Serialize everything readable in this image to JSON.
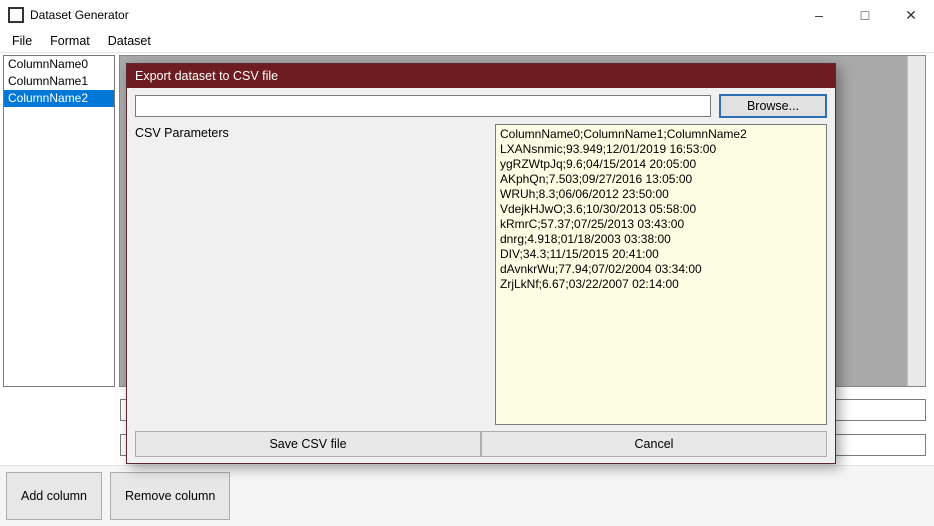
{
  "window": {
    "title": "Dataset Generator"
  },
  "menubar": {
    "file": "File",
    "format": "Format",
    "dataset": "Dataset"
  },
  "columns": {
    "items": [
      "ColumnName0",
      "ColumnName1",
      "ColumnName2"
    ],
    "selected_index": 2
  },
  "bottom": {
    "add": "Add column",
    "remove": "Remove column"
  },
  "modal": {
    "title": "Export dataset to CSV file",
    "path_value": "",
    "browse_label": "Browse...",
    "params_label": "CSV Parameters",
    "save_label": "Save CSV file",
    "cancel_label": "Cancel",
    "preview_lines": [
      "ColumnName0;ColumnName1;ColumnName2",
      "LXANsnmic;93.949;12/01/2019 16:53:00",
      "ygRZWtpJq;9.6;04/15/2014 20:05:00",
      "AKphQn;7.503;09/27/2016 13:05:00",
      "WRUh;8.3;06/06/2012 23:50:00",
      "VdejkHJwO;3.6;10/30/2013 05:58:00",
      "kRmrC;57.37;07/25/2013 03:43:00",
      "dnrg;4.918;01/18/2003 03:38:00",
      "DIV;34.3;11/15/2015 20:41:00",
      "dAvnkrWu;77.94;07/02/2004 03:34:00",
      "ZrjLkNf;6.67;03/22/2007 02:14:00"
    ]
  }
}
